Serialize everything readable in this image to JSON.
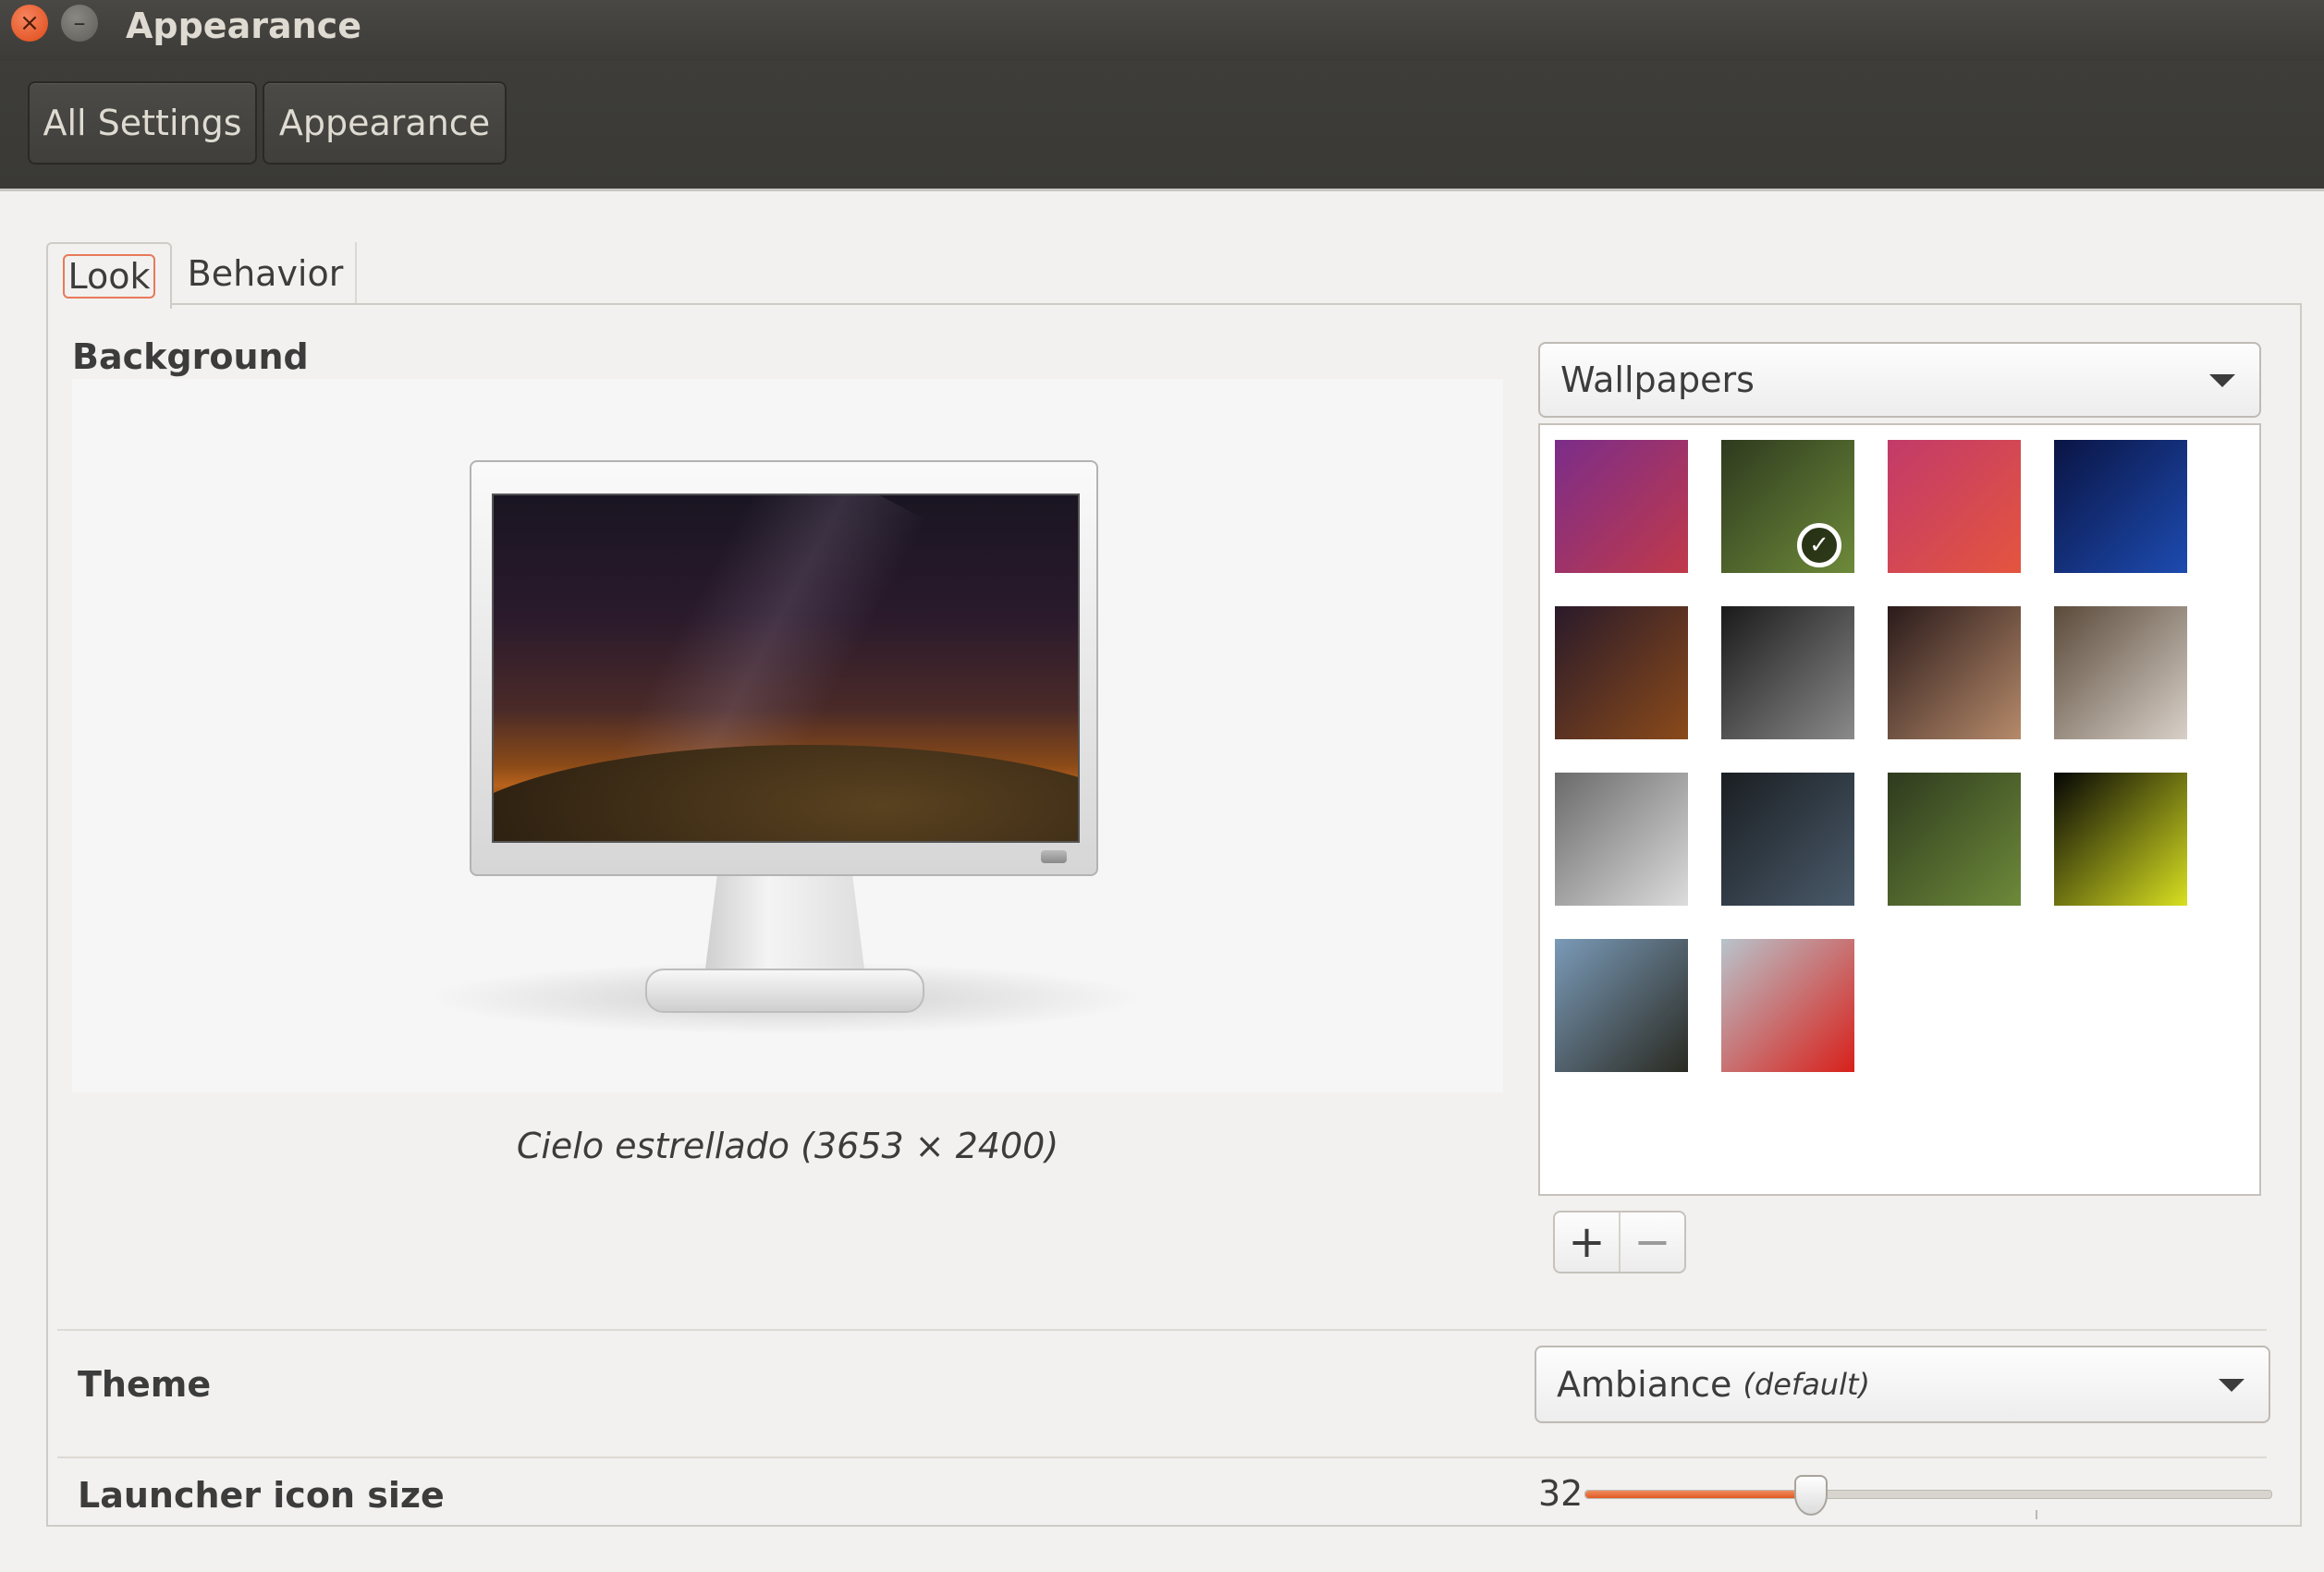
{
  "window": {
    "title": "Appearance"
  },
  "breadcrumbs": [
    {
      "label": "All Settings"
    },
    {
      "label": "Appearance"
    }
  ],
  "tabs": [
    {
      "label": "Look",
      "active": true
    },
    {
      "label": "Behavior",
      "active": false
    }
  ],
  "background": {
    "label": "Background",
    "source_selector": {
      "selected": "Wallpapers"
    },
    "caption": "Cielo estrellado (3653 × 2400)",
    "wallpapers": [
      {
        "colors": [
          "#7b2d8a",
          "#c0394a"
        ]
      },
      {
        "colors": [
          "#2e3a1e",
          "#6d8a3a"
        ],
        "selected": true
      },
      {
        "colors": [
          "#c23a6a",
          "#e4553e"
        ]
      },
      {
        "colors": [
          "#0a1444",
          "#1d4bb0"
        ]
      },
      {
        "colors": [
          "#2a1a2a",
          "#8a4a1a"
        ]
      },
      {
        "colors": [
          "#1a1a1a",
          "#8a8a8a"
        ]
      },
      {
        "colors": [
          "#2a1a1a",
          "#b68a6a"
        ]
      },
      {
        "colors": [
          "#5a4a3a",
          "#d8d0c8"
        ]
      },
      {
        "colors": [
          "#6a6a6a",
          "#dcdcdc"
        ]
      },
      {
        "colors": [
          "#1a1e22",
          "#4a5a6a"
        ]
      },
      {
        "colors": [
          "#2e3a1e",
          "#6d8a3a"
        ]
      },
      {
        "colors": [
          "#050505",
          "#d8e020"
        ]
      },
      {
        "colors": [
          "#7a9ab8",
          "#2a2a22"
        ]
      },
      {
        "colors": [
          "#b8c4cc",
          "#d8201a"
        ]
      }
    ],
    "add_icon": "plus-icon",
    "remove_icon": "minus-icon"
  },
  "theme": {
    "label": "Theme",
    "selected": "Ambiance",
    "selected_note": "(default)"
  },
  "launcher": {
    "label": "Launcher icon size",
    "value": "32",
    "level": 0.33
  },
  "accent": "#e05a22"
}
